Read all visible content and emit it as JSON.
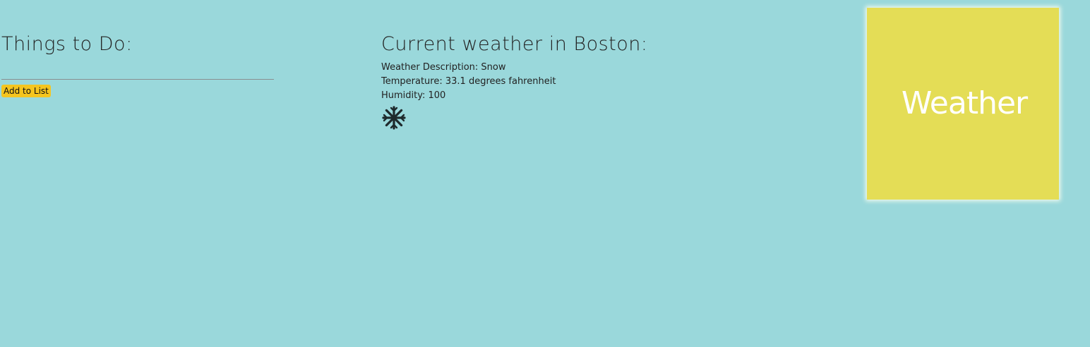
{
  "todo": {
    "heading": "Things to Do:",
    "input_value": "",
    "input_placeholder": "",
    "add_button_label": "Add to List"
  },
  "weather": {
    "heading": "Current weather in Boston:",
    "description_line": "Weather Description: Snow",
    "temperature_line": "Temperature: 33.1 degrees fahrenheit",
    "humidity_line": "Humidity: 100",
    "condition_icon": "snowflake-icon"
  },
  "logo": {
    "text": "Weather"
  },
  "colors": {
    "background": "#9ad8db",
    "button": "#f5c51f",
    "logo_background": "#e4dd56",
    "logo_text": "#ffffff",
    "text": "#222222"
  }
}
